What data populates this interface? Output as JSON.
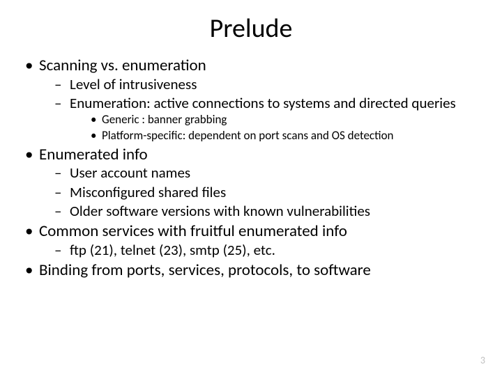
{
  "title": "Prelude",
  "bullets": [
    {
      "text": "Scanning vs. enumeration",
      "children": [
        {
          "text": "Level of intrusiveness"
        },
        {
          "text": "Enumeration: active connections to systems and directed queries",
          "children": [
            {
              "text": "Generic : banner grabbing"
            },
            {
              "text": "Platform-specific: dependent on port scans and OS detection"
            }
          ]
        }
      ]
    },
    {
      "text": "Enumerated info",
      "children": [
        {
          "text": "User account names"
        },
        {
          "text": "Misconfigured shared files"
        },
        {
          "text": "Older software versions with known vulnerabilities"
        }
      ]
    },
    {
      "text": "Common services with fruitful enumerated info",
      "children": [
        {
          "text": "ftp (21), telnet (23), smtp (25), etc."
        }
      ]
    },
    {
      "text": "Binding from ports, services, protocols, to software"
    }
  ],
  "pageNumber": "3"
}
